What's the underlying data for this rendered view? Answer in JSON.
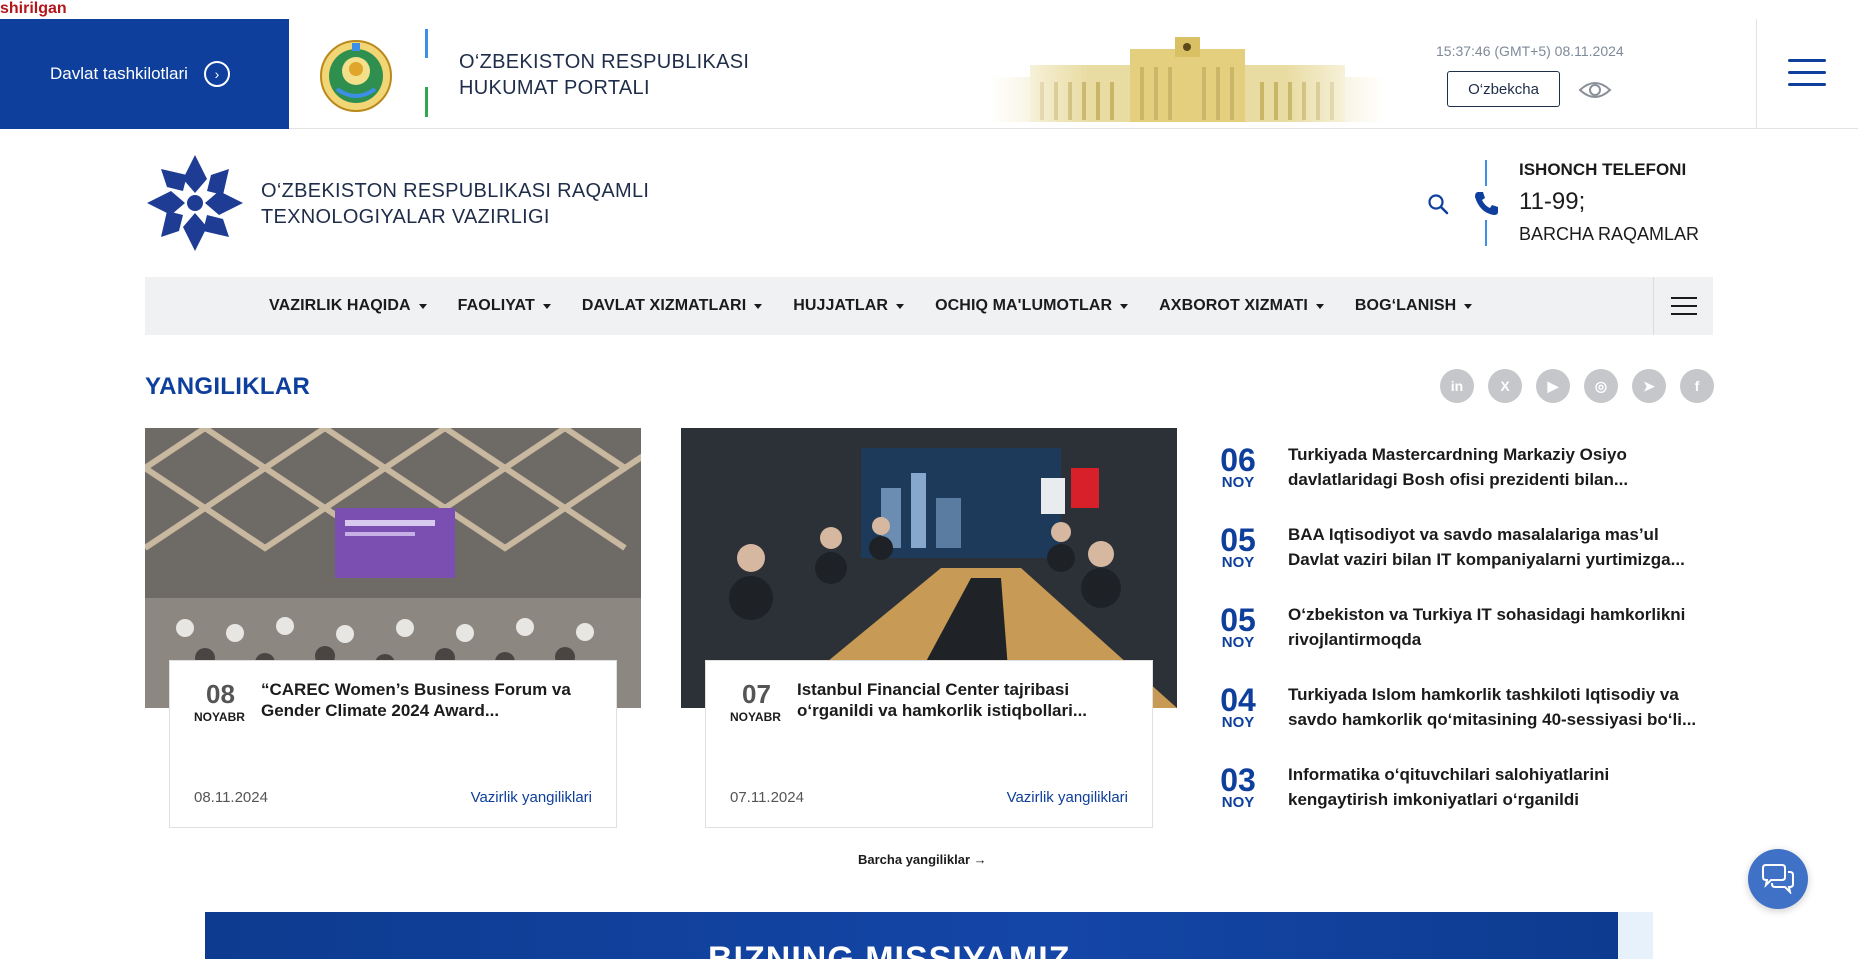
{
  "corner_label": "shirilgan",
  "top_bar": {
    "gov_button": "Davlat tashkilotlari",
    "portal_title_line1": "O‘ZBEKISTON RESPUBLIKASI",
    "portal_title_line2": "HUKUMAT PORTALI",
    "clock": "15:37:46 (GMT+5) 08.11.2024",
    "language": "O‘zbekcha"
  },
  "header": {
    "ministry_line1": "O‘ZBEKISTON RESPUBLIKASI RAQAMLI",
    "ministry_line2": "TEXNOLOGIYALAR VAZIRLIGI",
    "trust_title": "ISHONCH TELEFONI",
    "trust_number": "11-99;",
    "trust_all": "BARCHA RAQAMLAR"
  },
  "nav": {
    "items": [
      {
        "label": "VAZIRLIK HAQIDA"
      },
      {
        "label": "FAOLIYAT"
      },
      {
        "label": "DAVLAT XIZMATLARI"
      },
      {
        "label": "HUJJATLAR"
      },
      {
        "label": "OCHIQ MA'LUMOTLAR"
      },
      {
        "label": "AXBOROT XIZMATI"
      },
      {
        "label": "BOG‘LANISH"
      }
    ]
  },
  "news": {
    "section_title": "YANGILIKLAR",
    "socials": [
      "in",
      "X",
      "▶",
      "◎",
      "➤",
      "f"
    ],
    "featured": [
      {
        "day": "08",
        "month": "NOYABR",
        "title": "“CAREC Women’s Business Forum va Gender Climate 2024 Award...",
        "date": "08.11.2024",
        "category": "Vazirlik yangiliklari"
      },
      {
        "day": "07",
        "month": "NOYABR",
        "title": "Istanbul Financial Center tajribasi o‘rganildi va hamkorlik istiqbollari...",
        "date": "07.11.2024",
        "category": "Vazirlik yangiliklari"
      }
    ],
    "list": [
      {
        "day": "06",
        "month": "NOY",
        "title": "Turkiyada Mastercardning Markaziy Osiyo davlatlaridagi Bosh ofisi prezidenti bilan..."
      },
      {
        "day": "05",
        "month": "NOY",
        "title": "BAA Iqtisodiyot va savdo masalalariga mas’ul Davlat vaziri bilan IT kompaniyalarni yurtimizga..."
      },
      {
        "day": "05",
        "month": "NOY",
        "title": "O‘zbekiston va Turkiya IT sohasidagi hamkorlikni rivojlantirmoqda"
      },
      {
        "day": "04",
        "month": "NOY",
        "title": "Turkiyada Islom hamkorlik tashkiloti Iqtisodiy va savdo hamkorlik qo‘mitasining 40-sessiyasi bo‘li..."
      },
      {
        "day": "03",
        "month": "NOY",
        "title": "Informatika o‘qituvchilari salohiyatlarini kengaytirish imkoniyatlari o‘rganildi"
      }
    ],
    "all_news": "Barcha yangiliklar →"
  },
  "mission": {
    "title": "BIZNING MISSIYAMIZ"
  },
  "colors": {
    "brand_blue": "#0e3f9c",
    "nav_bg": "#f0f1f3",
    "social_gray": "#c5c7cb"
  }
}
